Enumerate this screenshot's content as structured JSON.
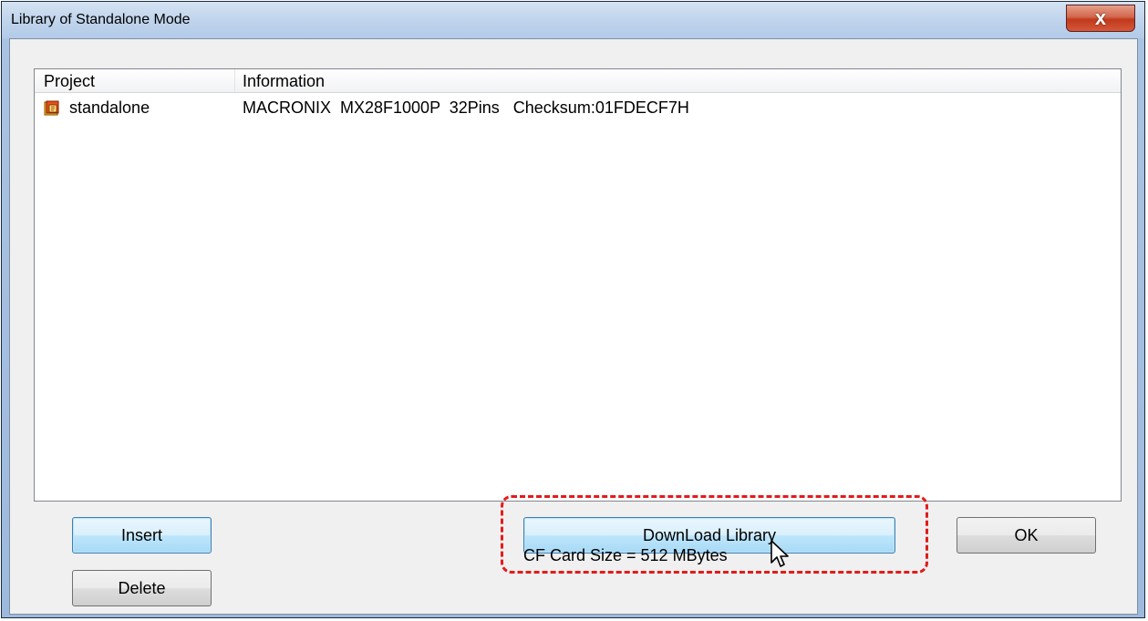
{
  "window": {
    "title": "Library of Standalone Mode",
    "close_glyph": "x"
  },
  "list": {
    "columns": [
      "Project",
      "Information"
    ],
    "rows": [
      {
        "icon": "project-file-icon",
        "project": "standalone",
        "information": "MACRONIX  MX28F1000P  32Pins   Checksum:01FDECF7H"
      }
    ]
  },
  "buttons": {
    "insert": "Insert",
    "delete": "Delete",
    "download": "DownLoad Library",
    "ok": "OK"
  },
  "status": {
    "cf_card_size": "CF Card Size = 512 MBytes"
  },
  "colors": {
    "highlight": "#e31b1b",
    "focus_border": "#3c7fb1"
  }
}
